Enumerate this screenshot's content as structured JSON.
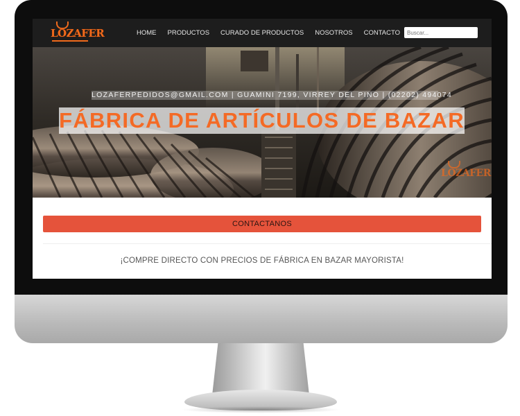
{
  "site": {
    "logo_text": "LOZAFER",
    "brand_color": "#f06a1c"
  },
  "nav": {
    "items": [
      {
        "label": "HOME"
      },
      {
        "label": "PRODUCTOS"
      },
      {
        "label": "CURADO DE PRODUCTOS"
      },
      {
        "label": "NOSOTROS"
      },
      {
        "label": "CONTACTO"
      }
    ],
    "search_placeholder": "Buscar..."
  },
  "hero": {
    "contact_line": "LOZAFERPEDIDOS@GMAIL.COM | GUAMINI 7199, VIRREY DEL PINO | (02202) 494074",
    "title": "FÁBRICA DE ARTÍCULOS DE BAZAR",
    "watermark_logo": "LOZAFER",
    "title_color": "#f46a25"
  },
  "content": {
    "contact_button_label": "CONTACTANOS",
    "button_color": "#e5533b",
    "tagline": "¡COMPRE DIRECTO CON PRECIOS DE FÁBRICA EN BAZAR MAYORISTA!"
  }
}
